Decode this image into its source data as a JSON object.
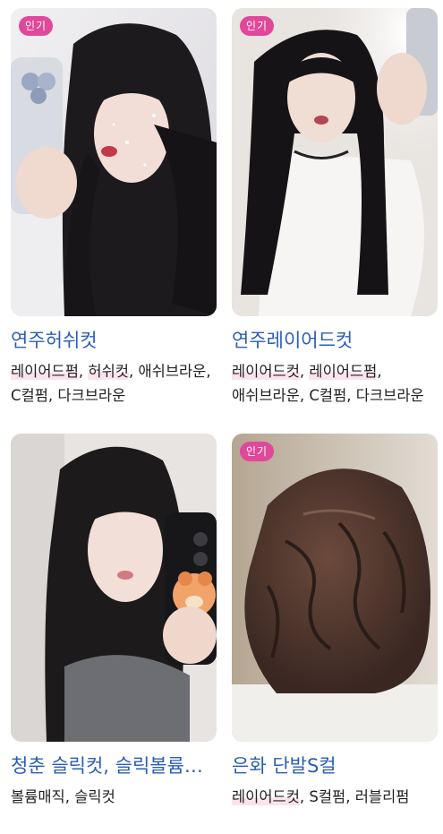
{
  "cards": [
    {
      "badge": "인기",
      "title": "연주허쉬컷",
      "tags": [
        "레이어드펌",
        "허쉬컷",
        "애쉬브라운",
        "C컬펌",
        "다크브라운"
      ],
      "highlighted": [
        0,
        1
      ],
      "image_icon": "photo-selfie-long-layered-hair"
    },
    {
      "badge": "인기",
      "title": "연주레이어드컷",
      "tags": [
        "레이어드컷",
        "레이어드펌",
        "애쉬브라운",
        "C컬펌",
        "다크브라운"
      ],
      "highlighted": [
        0,
        1
      ],
      "image_icon": "photo-selfie-layered-cut"
    },
    {
      "badge": "",
      "title": "청춘 슬릭컷, 슬릭볼륨매직",
      "tags": [
        "볼륨매직",
        "슬릭컷"
      ],
      "highlighted": [],
      "image_icon": "photo-selfie-sleek-cut"
    },
    {
      "badge": "인기",
      "title": "은화 단발S컬",
      "tags": [
        "레이어드컷",
        "S컬펌",
        "러블리펌"
      ],
      "highlighted": [
        0
      ],
      "image_icon": "photo-short-wavy-bob"
    }
  ],
  "separator": ", "
}
